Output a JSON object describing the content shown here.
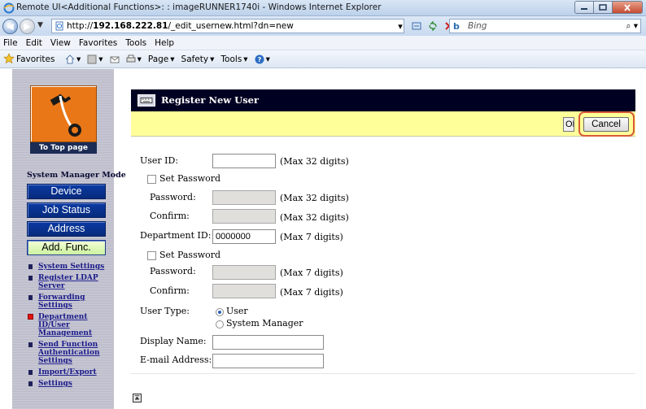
{
  "window": {
    "title": "Remote UI<Additional Functions>: : imageRUNNER1740i - Windows Internet Explorer"
  },
  "address_bar": {
    "url_prefix": "http://",
    "url_host": "192.168.222.81",
    "url_path": "/_edit_usernew.html?dn=new",
    "search_placeholder": "Bing",
    "search_provider": "b"
  },
  "menu": {
    "items": [
      "File",
      "Edit",
      "View",
      "Favorites",
      "Tools",
      "Help"
    ]
  },
  "favorites_bar": {
    "favorites_label": "Favorites",
    "page_label": "Page",
    "safety_label": "Safety",
    "tools_label": "Tools"
  },
  "sidebar": {
    "to_top_label": "To Top page",
    "mode_label": "System Manager Mode",
    "nav_buttons": [
      {
        "label": "Device"
      },
      {
        "label": "Job Status"
      },
      {
        "label": "Address"
      },
      {
        "label": "Add. Func."
      }
    ],
    "active_nav": "Add. Func.",
    "links": [
      {
        "label": "System Settings"
      },
      {
        "label": "Register LDAP Server"
      },
      {
        "label": "Forwarding Settings"
      },
      {
        "label": "Department ID/User Management"
      },
      {
        "label": "Send Function Authentication Settings"
      },
      {
        "label": "Import/Export"
      },
      {
        "label": "Settings"
      }
    ],
    "active_link": "Department ID/User Management"
  },
  "main": {
    "page_title": "Register New User",
    "ok_label": "OK",
    "cancel_label": "Cancel",
    "form": {
      "user_id_label": "User ID:",
      "user_id_value": "",
      "user_id_hint": "(Max 32 digits)",
      "set_password_label": "Set Password",
      "password_label": "Password:",
      "password_hint": "(Max 32 digits)",
      "confirm_label": "Confirm:",
      "confirm_hint": "(Max 32 digits)",
      "dept_id_label": "Department ID:",
      "dept_id_value": "0000000",
      "dept_id_hint": "(Max 7 digits)",
      "dept_set_password_label": "Set Password",
      "dept_password_label": "Password:",
      "dept_password_hint": "(Max 7 digits)",
      "dept_confirm_label": "Confirm:",
      "dept_confirm_hint": "(Max 7 digits)",
      "user_type_label": "User Type:",
      "user_type_options": [
        "User",
        "System Manager"
      ],
      "user_type_selected": "User",
      "display_name_label": "Display Name:",
      "display_name_value": "",
      "email_label": "E-mail Address:",
      "email_value": ""
    }
  },
  "colors": {
    "header_bar": "#000022",
    "action_bar": "#ffff99",
    "nav_button": "#0b3aa3",
    "nav_button_active": "#cdf2a0",
    "highlight_ring": "#d85a3a",
    "logo_tile": "#e97717"
  }
}
